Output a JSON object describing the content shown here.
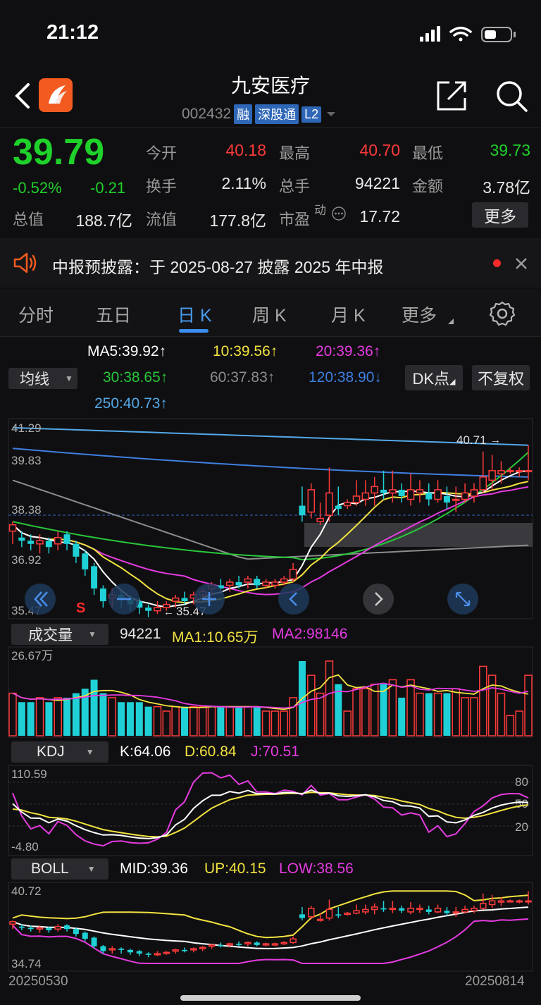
{
  "status": {
    "time": "21:12"
  },
  "header": {
    "stock_name": "九安医疗",
    "code": "002432",
    "tags": [
      "融",
      "深股通",
      "L2"
    ]
  },
  "quote": {
    "price": "39.79",
    "change_pct": "-0.52%",
    "change": "-0.21",
    "rows": [
      [
        {
          "label": "今开",
          "value": "40.18",
          "color": "red"
        },
        {
          "label": "最高",
          "value": "40.70",
          "color": "red"
        },
        {
          "label": "最低",
          "value": "39.73",
          "color": "green"
        }
      ],
      [
        {
          "label": "换手",
          "value": "2.11%"
        },
        {
          "label": "总手",
          "value": "94221"
        },
        {
          "label": "金额",
          "value": "3.78亿"
        }
      ]
    ],
    "total_value_label": "总值",
    "total_value": "188.7亿",
    "float_value_label": "流值",
    "float_value": "177.8亿",
    "pe_label": "市盈",
    "pe_sup": "动",
    "pe_value": "17.72",
    "more_label": "更多"
  },
  "notice": {
    "text": "中报预披露：于 2025-08-27 披露 2025 年中报"
  },
  "tabs": [
    "分时",
    "五日",
    "日 K",
    "周 K",
    "月 K",
    "更多"
  ],
  "ma_bar": {
    "selector": "均线",
    "ma5": "MA5:39.92↑",
    "ma10": "10:39.56↑",
    "ma20": "20:39.36↑",
    "ma30": "30:38.65↑",
    "ma60": "60:37.83↑",
    "ma120": "120:38.90↓",
    "ma250": "250:40.73↑",
    "dk_label": "DK点",
    "fq_label": "不复权"
  },
  "kline_axis": {
    "y_ticks": [
      "41.29",
      "39.83",
      "38.38",
      "36.92",
      "35.47"
    ],
    "high_mark": "40.71",
    "low_mark": "35.47",
    "signal": "S"
  },
  "volume": {
    "selector": "成交量",
    "value": "94221",
    "ma1": "MA1:10.65万",
    "ma2": "MA2:98146",
    "y_top": "26.67万"
  },
  "kdj": {
    "selector": "KDJ",
    "k": "K:64.06",
    "d": "D:60.84",
    "j": "J:70.51",
    "y_top": "110.59",
    "y_bottom": "-4.80",
    "levels": [
      "80",
      "50",
      "20"
    ]
  },
  "boll": {
    "selector": "BOLL",
    "mid": "MID:39.36",
    "up": "UP:40.15",
    "low": "LOW:38.56",
    "y_top": "40.72",
    "y_bottom": "34.74"
  },
  "dates": {
    "start": "20250530",
    "end": "20250814"
  },
  "colors": {
    "up": "#ff3b3b",
    "down": "#1fd1d6",
    "ma5": "#ffffff",
    "ma10": "#f2e240",
    "ma20": "#e53be0",
    "ma30": "#28c83a",
    "ma60": "#8c8c8c",
    "ma120": "#3f7fe0",
    "ma250": "#54a8e8"
  },
  "chart_data": {
    "type": "candlestick",
    "candles": [
      [
        38.0,
        38.2,
        37.6,
        38.3
      ],
      [
        37.8,
        37.7,
        37.5,
        38.0
      ],
      [
        37.7,
        37.6,
        37.4,
        37.9
      ],
      [
        37.6,
        37.7,
        37.3,
        37.9
      ],
      [
        37.7,
        37.5,
        37.3,
        37.8
      ],
      [
        37.6,
        37.8,
        37.4,
        38.0
      ],
      [
        37.9,
        37.6,
        37.4,
        38.0
      ],
      [
        37.6,
        37.2,
        37.0,
        37.7
      ],
      [
        37.3,
        36.8,
        36.6,
        37.4
      ],
      [
        36.9,
        36.2,
        36.0,
        37.0
      ],
      [
        36.2,
        35.8,
        35.6,
        36.3
      ],
      [
        35.9,
        36.0,
        35.6,
        36.2
      ],
      [
        36.0,
        35.9,
        35.6,
        36.1
      ],
      [
        35.9,
        35.7,
        35.5,
        36.0
      ],
      [
        35.8,
        35.6,
        35.4,
        35.9
      ],
      [
        35.6,
        35.5,
        35.3,
        35.7
      ],
      [
        35.5,
        35.6,
        35.4,
        35.8
      ],
      [
        35.6,
        35.7,
        35.5,
        35.8
      ],
      [
        35.8,
        35.9,
        35.6,
        36.0
      ],
      [
        35.9,
        35.8,
        35.7,
        36.1
      ],
      [
        35.9,
        36.0,
        35.7,
        36.1
      ],
      [
        36.0,
        36.1,
        35.8,
        36.2
      ],
      [
        36.2,
        36.3,
        36.0,
        36.4
      ],
      [
        36.3,
        36.2,
        36.1,
        36.5
      ],
      [
        36.3,
        36.4,
        36.1,
        36.5
      ],
      [
        36.4,
        36.3,
        36.2,
        36.6
      ],
      [
        36.4,
        36.5,
        36.2,
        36.6
      ],
      [
        36.5,
        36.3,
        36.2,
        36.6
      ],
      [
        36.3,
        36.4,
        36.2,
        36.5
      ],
      [
        36.3,
        36.4,
        36.2,
        36.5
      ],
      [
        36.4,
        36.5,
        36.3,
        36.6
      ],
      [
        36.5,
        36.8,
        36.4,
        37.0
      ],
      [
        38.8,
        38.5,
        38.3,
        39.4
      ],
      [
        38.6,
        39.3,
        38.4,
        39.5
      ],
      [
        38.3,
        38.4,
        38.2,
        38.9
      ],
      [
        38.5,
        39.2,
        38.3,
        40.0
      ],
      [
        38.8,
        38.7,
        38.5,
        39.4
      ],
      [
        38.8,
        38.9,
        38.7,
        39.0
      ],
      [
        38.9,
        39.1,
        38.8,
        39.6
      ],
      [
        39.0,
        39.2,
        38.8,
        39.6
      ],
      [
        39.2,
        39.4,
        38.8,
        39.7
      ],
      [
        39.3,
        39.2,
        39.0,
        39.9
      ],
      [
        39.2,
        39.3,
        38.9,
        39.9
      ],
      [
        39.3,
        39.1,
        38.9,
        39.5
      ],
      [
        39.0,
        39.3,
        38.8,
        39.8
      ],
      [
        39.2,
        39.3,
        38.9,
        39.6
      ],
      [
        39.2,
        39.0,
        38.8,
        39.5
      ],
      [
        39.0,
        39.3,
        38.9,
        39.6
      ],
      [
        39.1,
        38.9,
        38.7,
        39.4
      ],
      [
        39.0,
        39.0,
        38.6,
        39.4
      ],
      [
        39.0,
        39.2,
        38.9,
        39.5
      ],
      [
        39.1,
        39.3,
        38.9,
        39.5
      ],
      [
        39.3,
        39.7,
        39.2,
        40.5
      ],
      [
        39.6,
        39.9,
        39.3,
        40.4
      ],
      [
        39.8,
        39.9,
        39.5,
        40.2
      ],
      [
        39.9,
        39.9,
        39.8,
        40.0
      ],
      [
        39.9,
        39.9,
        39.7,
        40.0
      ],
      [
        39.9,
        39.9,
        39.6,
        40.7
      ]
    ],
    "ylim": [
      35.47,
      41.29
    ]
  }
}
